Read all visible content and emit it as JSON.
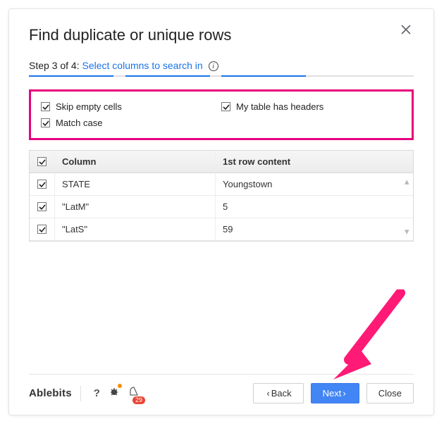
{
  "dialog": {
    "title": "Find duplicate or unique rows",
    "step_prefix": "Step 3 of 4: ",
    "step_link": "Select columns to search in"
  },
  "options": {
    "skip_empty": {
      "label": "Skip empty cells",
      "checked": true
    },
    "headers": {
      "label": "My table has headers",
      "checked": true
    },
    "match_case": {
      "label": "Match case",
      "checked": true
    }
  },
  "table": {
    "header_col": "Column",
    "header_content": "1st row content",
    "rows": [
      {
        "checked": true,
        "column": "STATE",
        "content": "Youngstown"
      },
      {
        "checked": true,
        "column": "\"LatM\"",
        "content": "5"
      },
      {
        "checked": true,
        "column": "\"LatS\"",
        "content": "59"
      }
    ]
  },
  "footer": {
    "brand": "Ablebits",
    "help": "?",
    "notification_count": "29",
    "back": "Back",
    "next": "Next",
    "close": "Close"
  }
}
